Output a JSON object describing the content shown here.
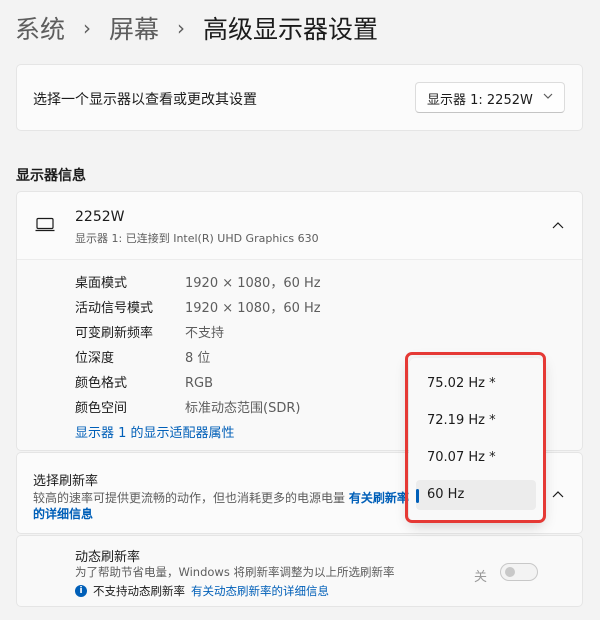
{
  "breadcrumb": {
    "items": [
      "系统",
      "屏幕"
    ],
    "separator": "›",
    "current": "高级显示器设置"
  },
  "display_select": {
    "prompt": "选择一个显示器以查看或更改其设置",
    "selected": "显示器 1: 2252W"
  },
  "section_title": "显示器信息",
  "monitor": {
    "name": "2252W",
    "subtitle": "显示器 1: 已连接到 Intel(R) UHD Graphics 630",
    "details": [
      {
        "key": "桌面模式",
        "value": "1920 × 1080，60 Hz"
      },
      {
        "key": "活动信号模式",
        "value": "1920 × 1080，60 Hz"
      },
      {
        "key": "可变刷新频率",
        "value": "不支持"
      },
      {
        "key": "位深度",
        "value": "8 位"
      },
      {
        "key": "颜色格式",
        "value": "RGB"
      },
      {
        "key": "颜色空间",
        "value": "标准动态范围(SDR)"
      }
    ],
    "adapter_link": "显示器 1 的显示适配器属性"
  },
  "refresh_rate": {
    "title": "选择刷新率",
    "description": "较高的速率可提供更流畅的动作，但也消耗更多的电源电量",
    "link": "有关刷新率的详细信息",
    "options": [
      "75.02 Hz *",
      "72.19 Hz *",
      "70.07 Hz *",
      "60 Hz"
    ],
    "selected_index": 3
  },
  "dynamic_refresh": {
    "title": "动态刷新率",
    "description": "为了帮助节省电量，Windows 将刷新率调整为以上所选刷新率",
    "info_text": "不支持动态刷新率",
    "info_link": "有关动态刷新率的详细信息",
    "toggle_label": "关",
    "toggle_on": false
  },
  "colors": {
    "accent": "#005fb8",
    "highlight": "#e53935"
  }
}
